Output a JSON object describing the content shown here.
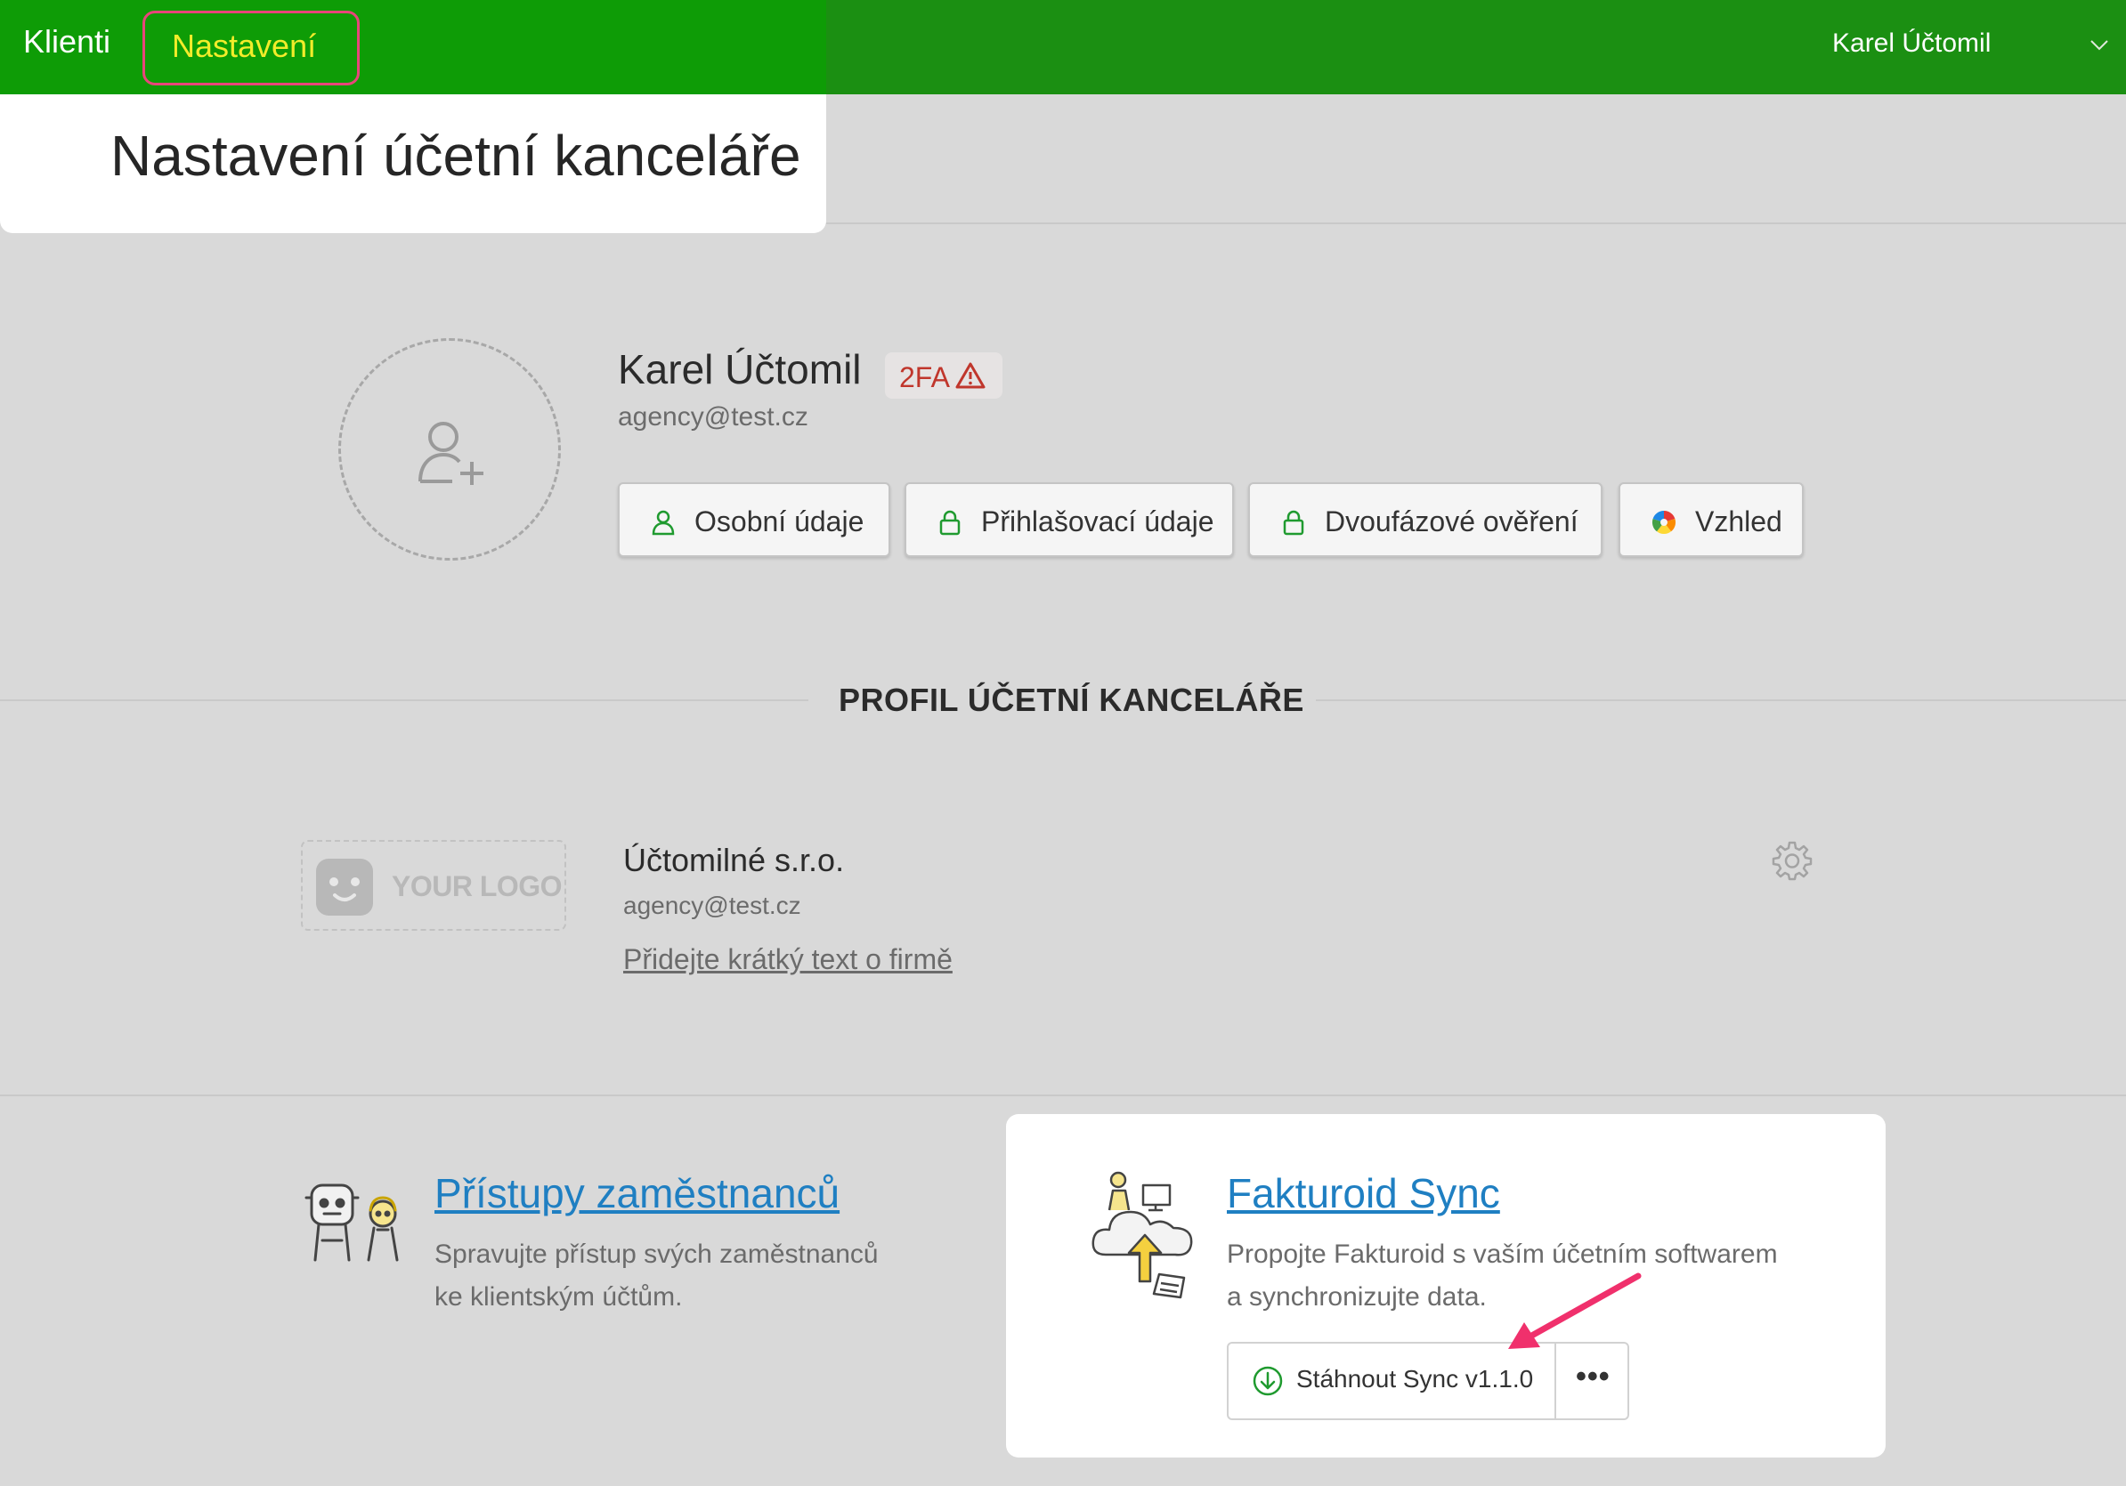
{
  "nav": {
    "clients": "Klienti",
    "settings": "Nastavení",
    "user": "Karel Účtomil"
  },
  "header": {
    "title": "Nastavení účetní kanceláře"
  },
  "profile": {
    "name": "Karel Účtomil",
    "badge": "2FA",
    "email": "agency@test.cz",
    "buttons": {
      "personal": "Osobní údaje",
      "login": "Přihlašovací údaje",
      "twofactor": "Dvoufázové ověření",
      "appearance": "Vzhled"
    }
  },
  "section": {
    "title": "PROFIL ÚČETNÍ KANCELÁŘE"
  },
  "company": {
    "logo_placeholder": "YOUR LOGO",
    "name": "Účtomilné s.r.o.",
    "email": "agency@test.cz",
    "about_link": "Přidejte krátký text o firmě"
  },
  "employees": {
    "title": "Přístupy zaměstnanců",
    "desc_line1": "Spravujte přístup svých zaměstnanců",
    "desc_line2": "ke klientským účtům."
  },
  "sync": {
    "title": "Fakturoid Sync",
    "desc_line1": "Propojte Fakturoid s vaším účetním softwarem",
    "desc_line2": "a synchronizujte data.",
    "download": "Stáhnout Sync v1.1.0",
    "more": "•••"
  },
  "colors": {
    "topbar": "#1b8f12",
    "accent_yellow": "#f2ec2a",
    "highlight_pink": "#e8457a",
    "link_blue": "#1f7fc2",
    "warning_red": "#c0362c"
  }
}
